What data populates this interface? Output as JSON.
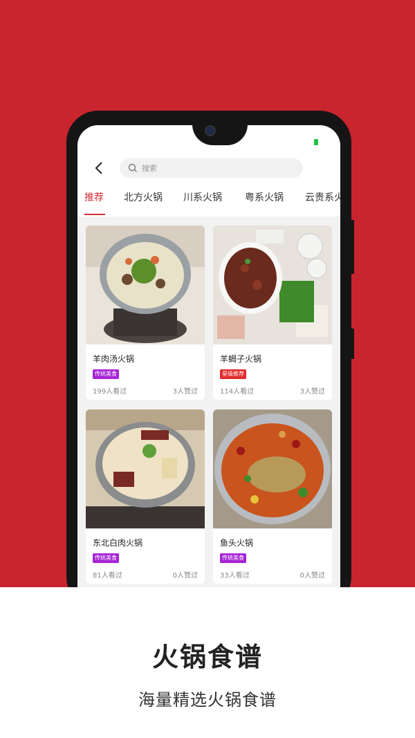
{
  "search": {
    "placeholder": "搜索"
  },
  "tabs": [
    {
      "label": "推荐"
    },
    {
      "label": "北方火锅"
    },
    {
      "label": "川系火锅"
    },
    {
      "label": "粤系火锅"
    },
    {
      "label": "云贵系火"
    }
  ],
  "cards": [
    {
      "title": "羊肉汤火锅",
      "tag": "传统美食",
      "tag_color": "#a523d6",
      "views": "199人看过",
      "likes": "3人赞过"
    },
    {
      "title": "羊蝎子火锅",
      "tag": "星级推荐",
      "tag_color": "#e12a2a",
      "views": "114人看过",
      "likes": "3人赞过"
    },
    {
      "title": "东北白肉火锅",
      "tag": "传统美食",
      "tag_color": "#a523d6",
      "views": "81人看过",
      "likes": "0人赞过"
    },
    {
      "title": "鱼头火锅",
      "tag": "传统美食",
      "tag_color": "#a523d6",
      "views": "33人看过",
      "likes": "0人赞过"
    }
  ],
  "promo": {
    "title": "火锅食谱",
    "subtitle": "海量精选火锅食谱"
  },
  "colors": {
    "background": "#c8252e",
    "accent": "#d62c34"
  }
}
